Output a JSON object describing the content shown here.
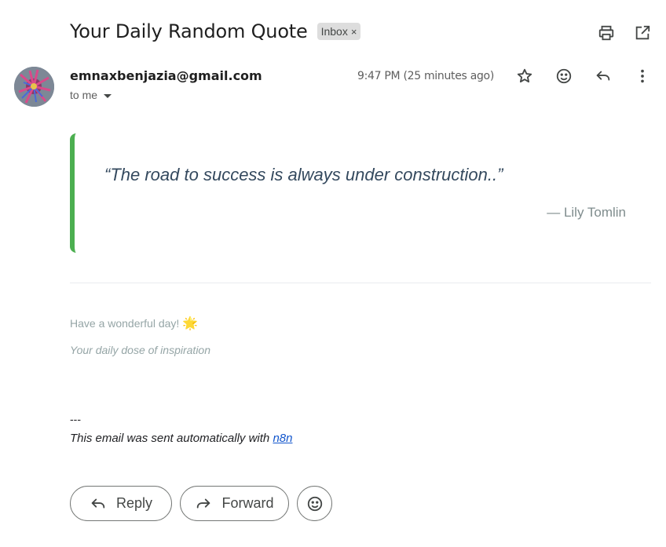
{
  "email": {
    "subject": "Your Daily Random Quote",
    "label": "Inbox",
    "label_remove": "×",
    "sender": "emnaxbenjazia@gmail.com",
    "recipient": "to me",
    "timestamp": "9:47 PM (25 minutes ago)"
  },
  "top_actions": {
    "print_icon": "print-icon",
    "popout_icon": "open-in-new-window-icon"
  },
  "message_actions": {
    "star_icon": "star-icon",
    "emoji_icon": "emoji-reaction-icon",
    "reply_icon": "reply-icon",
    "more_icon": "more-vert-icon"
  },
  "body": {
    "quote": "“The road to success is always under construction..”",
    "author": "— Lily Tomlin",
    "greeting": "Have a wonderful day!",
    "greeting_emoji": "🌟",
    "tagline": "Your daily dose of inspiration",
    "signature_dash": "---",
    "signature_text": "This email was sent automatically with ",
    "signature_link": "n8n"
  },
  "footer": {
    "reply_label": "Reply",
    "forward_label": "Forward"
  },
  "colors": {
    "quote_border": "#4caf50",
    "quote_text": "#34495e",
    "muted_text": "#95a5a6",
    "link": "#1155cc"
  }
}
